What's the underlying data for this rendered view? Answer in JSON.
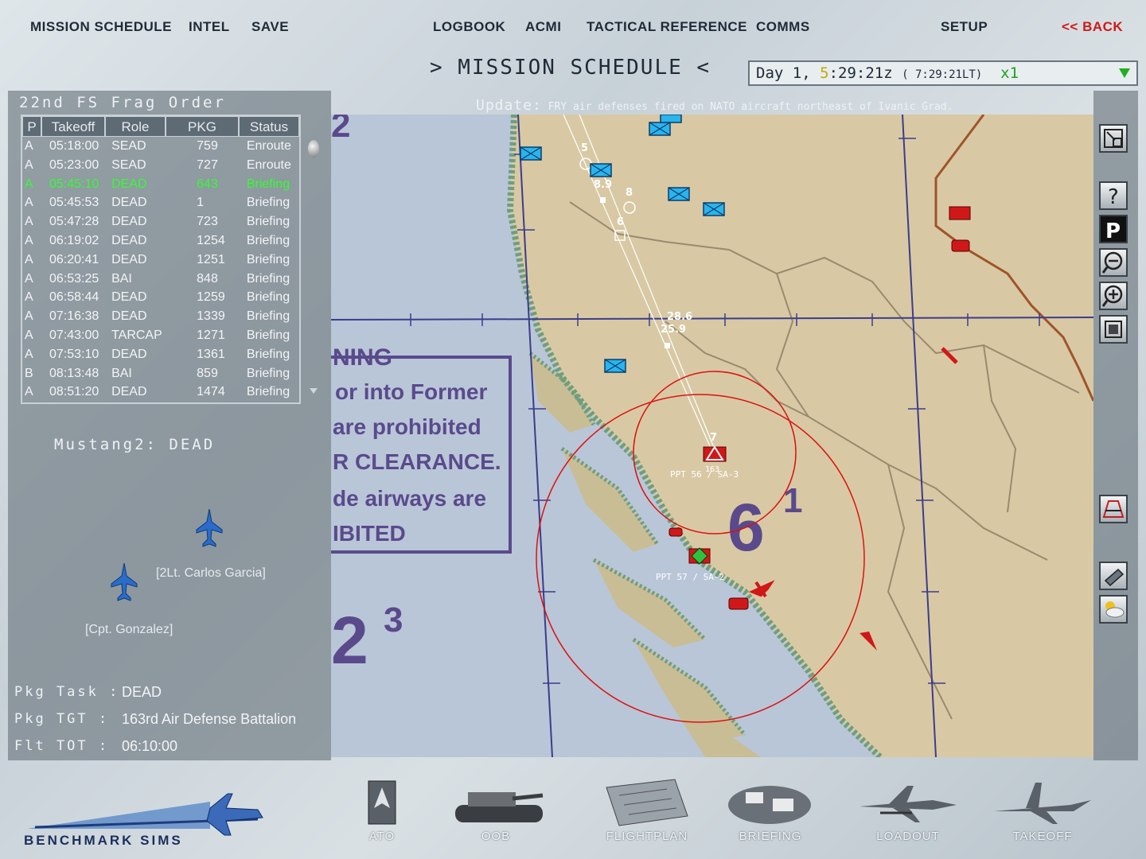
{
  "topmenu": {
    "mission_schedule": "MISSION SCHEDULE",
    "intel": "INTEL",
    "save": "SAVE",
    "logbook": "LOGBOOK",
    "acmi": "ACMI",
    "tactical_reference": "TACTICAL REFERENCE",
    "comms": "COMMS",
    "setup": "SETUP",
    "back": "<< BACK"
  },
  "screen_title": ">  MISSION SCHEDULE  <",
  "clock": {
    "day_label": "Day",
    "day": "1,",
    "hour": "5",
    "time_rest": ":29:21z",
    "local": "( 7:29:21LT)",
    "speed": "x1"
  },
  "frag": {
    "title": "22nd FS Frag Order",
    "columns": [
      "P",
      "Takeoff",
      "Role",
      "PKG",
      "Status"
    ],
    "rows": [
      {
        "p": "A",
        "takeoff": "05:18:00",
        "role": "SEAD",
        "pkg": "759",
        "status": "Enroute"
      },
      {
        "p": "A",
        "takeoff": "05:23:00",
        "role": "SEAD",
        "pkg": "727",
        "status": "Enroute"
      },
      {
        "p": "A",
        "takeoff": "05:45:10",
        "role": "DEAD",
        "pkg": "643",
        "status": "Briefing"
      },
      {
        "p": "A",
        "takeoff": "05:45:53",
        "role": "DEAD",
        "pkg": "1",
        "status": "Briefing"
      },
      {
        "p": "A",
        "takeoff": "05:47:28",
        "role": "DEAD",
        "pkg": "723",
        "status": "Briefing"
      },
      {
        "p": "A",
        "takeoff": "06:19:02",
        "role": "DEAD",
        "pkg": "1254",
        "status": "Briefing"
      },
      {
        "p": "A",
        "takeoff": "06:20:41",
        "role": "DEAD",
        "pkg": "1251",
        "status": "Briefing"
      },
      {
        "p": "A",
        "takeoff": "06:53:25",
        "role": "BAI",
        "pkg": "848",
        "status": "Briefing"
      },
      {
        "p": "A",
        "takeoff": "06:58:44",
        "role": "DEAD",
        "pkg": "1259",
        "status": "Briefing"
      },
      {
        "p": "A",
        "takeoff": "07:16:38",
        "role": "DEAD",
        "pkg": "1339",
        "status": "Briefing"
      },
      {
        "p": "A",
        "takeoff": "07:43:00",
        "role": "TARCAP",
        "pkg": "1271",
        "status": "Briefing"
      },
      {
        "p": "A",
        "takeoff": "07:53:10",
        "role": "DEAD",
        "pkg": "1361",
        "status": "Briefing"
      },
      {
        "p": "B",
        "takeoff": "08:13:48",
        "role": "BAI",
        "pkg": "859",
        "status": "Briefing"
      },
      {
        "p": "A",
        "takeoff": "08:51:20",
        "role": "DEAD",
        "pkg": "1474",
        "status": "Briefing"
      }
    ],
    "selected_index": 2
  },
  "flight": {
    "name": "Mustang2: DEAD",
    "pilots": [
      "[2Lt. Carlos Garcia]",
      "[Cpt. Gonzalez]"
    ]
  },
  "package": {
    "task_label": "Pkg Task :",
    "task": "DEAD",
    "target_label": "Pkg TGT  :",
    "target": "163rd Air Defense Battalion",
    "tot_label": "Flt TOT  :",
    "tot": "06:10:00"
  },
  "update": {
    "label": "Update:",
    "text": "FRY air defenses fired on NATO aircraft northeast of Ivanic Grad."
  },
  "map": {
    "waypoint_labels": [
      "5",
      "8.9",
      "8",
      "6",
      "28.6",
      "25.9",
      "7"
    ],
    "ppt_labels": [
      "PPT 56 / SA-3",
      "PPT 57 / SA-2"
    ],
    "ppt_sub": "163",
    "chart_text": [
      "NING",
      "or into Former",
      "are prohibited",
      "R CLEARANCE.",
      "de airways are",
      "IBITED"
    ],
    "chart_big": [
      "6",
      "1",
      "2",
      "3",
      "2"
    ]
  },
  "tools": [
    "resize-icon",
    "help-icon",
    "p-icon",
    "zoom-out-icon",
    "zoom-in-icon",
    "fit-icon",
    "threat-icon",
    "weather-front-icon",
    "weather-icon"
  ],
  "bottom": {
    "brand": "BENCHMARK SIMS",
    "items": [
      "ATO",
      "OOB",
      "FLIGHTPLAN",
      "BRIEFING",
      "LOADOUT",
      "TAKEOFF"
    ]
  },
  "colors": {
    "selected_row": "#30ff30",
    "back": "#d01818",
    "threat_ring": "#dd1111",
    "map_land": "#d8c9a4",
    "map_sea": "#b9c6d7"
  }
}
